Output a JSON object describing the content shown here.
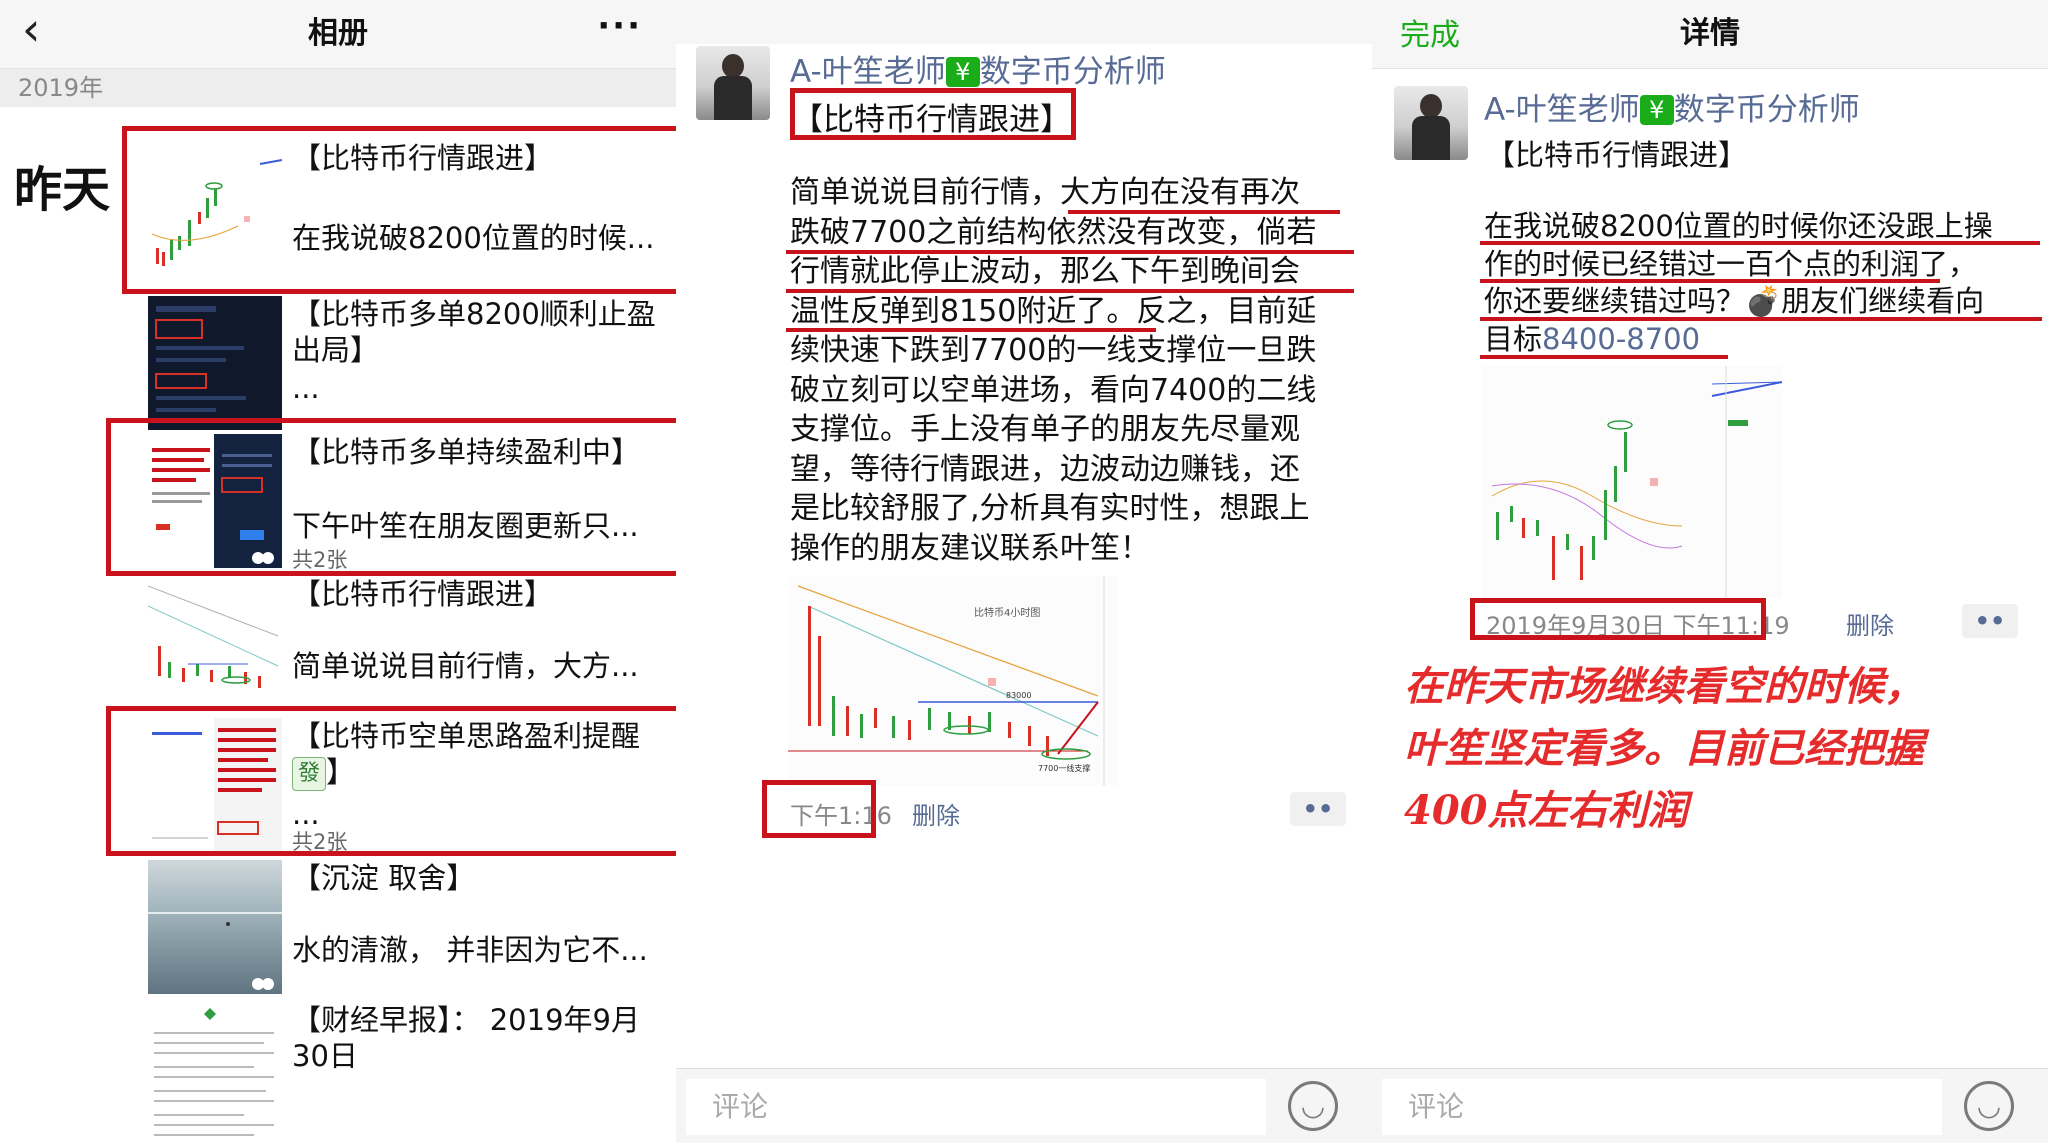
{
  "album": {
    "title": "相册",
    "back": "‹",
    "more": "···",
    "year": "2019年",
    "day": "昨天",
    "entries": [
      {
        "title": "【比特币行情跟进】",
        "text": "在我说破8200位置的时候..."
      },
      {
        "title": "【比特币多单8200顺利止盈出局】",
        "text": "..."
      },
      {
        "title": "【比特币多单持续盈利中】",
        "text": "下午叶笙在朋友圈更新只...",
        "count": "共2张"
      },
      {
        "title": "【比特币行情跟进】",
        "text": "简单说说目前行情，大方..."
      },
      {
        "title": "【比特币空单思路盈利提醒",
        "title_tail": "】",
        "text": "...",
        "count": "共2张",
        "glyph": "發"
      },
      {
        "title": "【沉淀 取舍】",
        "text": "水的清澈， 并非因为它不..."
      },
      {
        "title": "【财经早报】： 2019年9月30日"
      }
    ]
  },
  "detail1": {
    "author_prefix": "A-叶笙老师",
    "author_badge": "¥",
    "author_suffix": "数字币分析师",
    "post_title": "【比特币行情跟进】",
    "body_lines": [
      "简单说说目前行情，大方向在没有再次",
      "跌破7700之前结构依然没有改变，倘若",
      "行情就此停止波动，那么下午到晚间会",
      "温性反弹到8150附近了。反之，目前延",
      "续快速下跌到7700的一线支撑位一旦跌",
      "破立刻可以空单进场，看向7400的二线",
      "支撑位。手上没有单子的朋友先尽量观",
      "望，等待行情跟进，边波动边赚钱，还",
      "是比较舒服了,分析具有实时性，想跟上",
      "操作的朋友建议联系叶笙！"
    ],
    "time": "下午1:16",
    "delete": "删除",
    "dots": "••",
    "comment_placeholder": "评论",
    "chart_caption": "比特币4小时图",
    "chart_label_8300": "83000",
    "chart_label_7700": "7700一线支撑"
  },
  "detail2": {
    "done": "完成",
    "title": "详情",
    "author_prefix": "A-叶笙老师",
    "author_badge": "¥",
    "author_suffix": "数字币分析师",
    "post_title": "【比特币行情跟进】",
    "body_lines": [
      "在我说破8200位置的时候你还没跟上操",
      "作的时候已经错过一百个点的利润了，",
      "你还要继续错过吗？💣朋友们继续看向",
      "目标"
    ],
    "target_link": "8400-8700",
    "time": "2019年9月30日 下午11:19",
    "delete": "删除",
    "dots": "••",
    "comment_placeholder": "评论",
    "annotation_lines": [
      "在昨天市场继续看空的时候，",
      "叶笙坚定看多。目前已经把握",
      "400点左右利润"
    ]
  },
  "colors": {
    "accent_red": "#c8121c",
    "link_blue": "#576b95",
    "wechat_green": "#1aad19",
    "annotation_red": "#e52b2b"
  }
}
